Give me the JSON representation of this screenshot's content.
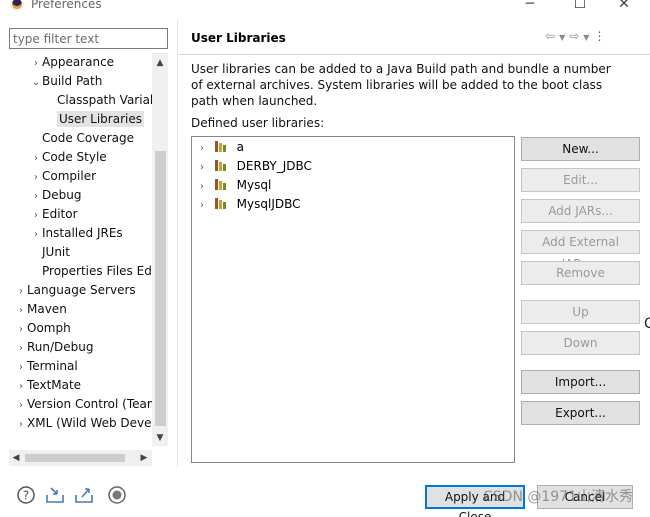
{
  "window": {
    "title": "Preferences",
    "controls": {
      "minimize": "─",
      "maximize": "☐",
      "close": "✕"
    }
  },
  "filter": {
    "placeholder": "type filter text"
  },
  "tree": {
    "items": [
      {
        "label": "Appearance",
        "chevron": "›",
        "selected": false
      },
      {
        "label": "Build Path",
        "chevron": "⌄",
        "selected": false
      },
      {
        "label": "Classpath Variab",
        "chevron": "",
        "selected": false
      },
      {
        "label": "User Libraries",
        "chevron": "",
        "selected": true
      },
      {
        "label": "Code Coverage",
        "chevron": "",
        "selected": false
      },
      {
        "label": "Code Style",
        "chevron": "›",
        "selected": false
      },
      {
        "label": "Compiler",
        "chevron": "›",
        "selected": false
      },
      {
        "label": "Debug",
        "chevron": "›",
        "selected": false
      },
      {
        "label": "Editor",
        "chevron": "›",
        "selected": false
      },
      {
        "label": "Installed JREs",
        "chevron": "›",
        "selected": false
      },
      {
        "label": "JUnit",
        "chevron": "",
        "selected": false
      },
      {
        "label": "Properties Files Edi",
        "chevron": "",
        "selected": false
      },
      {
        "label": "Language Servers",
        "chevron": "›",
        "selected": false
      },
      {
        "label": "Maven",
        "chevron": "›",
        "selected": false
      },
      {
        "label": "Oomph",
        "chevron": "›",
        "selected": false
      },
      {
        "label": "Run/Debug",
        "chevron": "›",
        "selected": false
      },
      {
        "label": "Terminal",
        "chevron": "›",
        "selected": false
      },
      {
        "label": "TextMate",
        "chevron": "›",
        "selected": false
      },
      {
        "label": "Version Control (Team",
        "chevron": "›",
        "selected": false
      },
      {
        "label": "XML (Wild Web Devel",
        "chevron": "›",
        "selected": false
      }
    ]
  },
  "page": {
    "title": "User Libraries",
    "description": "User libraries can be added to a Java Build path and bundle a number of external archives. System libraries will be added to the boot class path when launched.",
    "defined_label": "Defined user libraries:",
    "libraries": [
      "a",
      "DERBY_JDBC",
      "Mysql",
      "MysqlJDBC"
    ]
  },
  "buttons": {
    "new": "New...",
    "edit": "Edit...",
    "add_jars": "Add JARs...",
    "add_external_jars": "Add External JARs...",
    "remove": "Remove",
    "up": "Up",
    "down": "Down",
    "import": "Import...",
    "export": "Export..."
  },
  "footer": {
    "apply_and_close": "Apply and Close",
    "cancel": "Cancel",
    "watermark": "CSDN @1971山清水秀"
  },
  "colors": {
    "accent": "#0078d7",
    "selection": "#e3e3e3",
    "button": "#e1e1e1"
  }
}
